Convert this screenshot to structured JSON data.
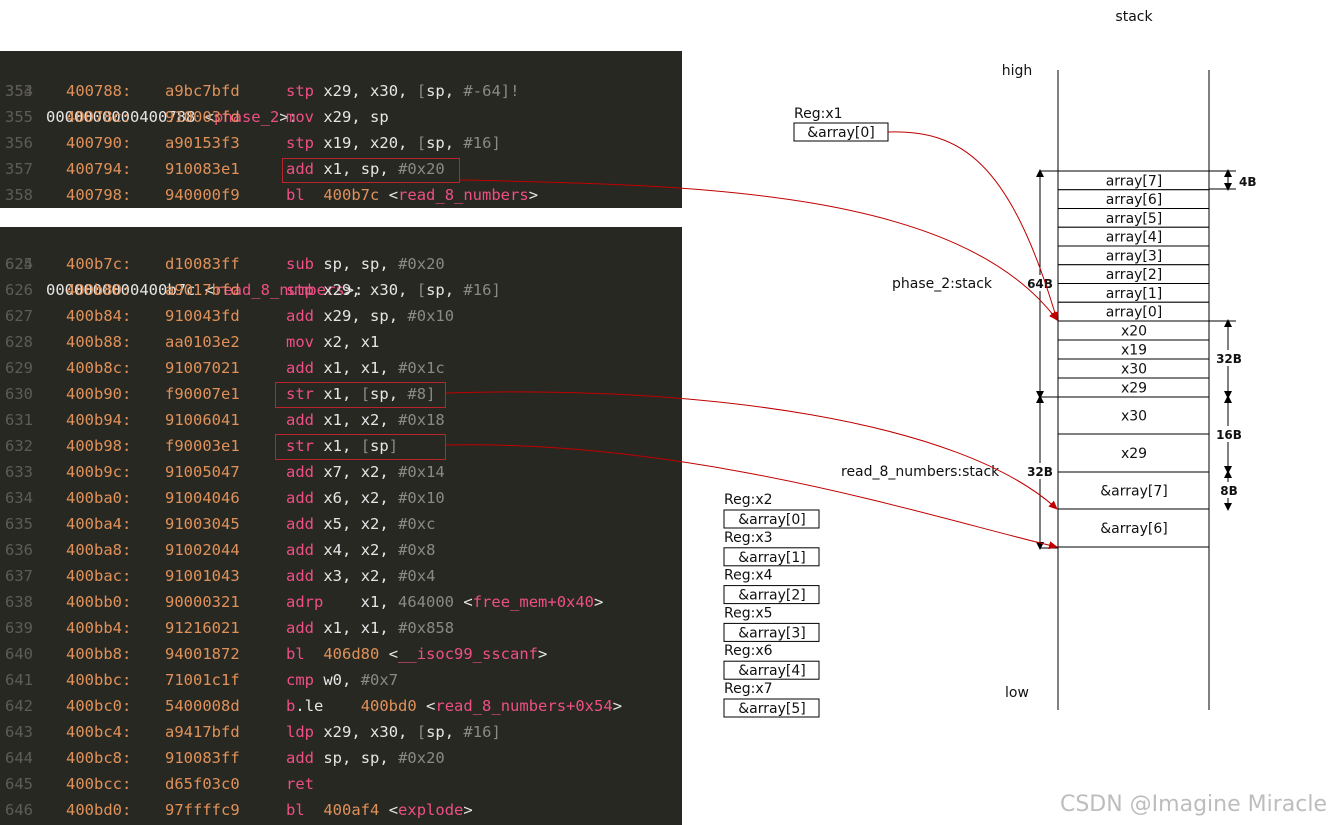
{
  "code_panel_1": {
    "header": {
      "line": "353",
      "address": "0000000000400788",
      "symbol": "phase_2"
    },
    "rows": [
      {
        "line": "354",
        "addr": "400788:",
        "hex": "a9bc7bfd",
        "ins": "stp x29, x30, [sp, #-64]!"
      },
      {
        "line": "355",
        "addr": "40078c:",
        "hex": "910003fd",
        "ins": "mov x29, sp"
      },
      {
        "line": "356",
        "addr": "400790:",
        "hex": "a90153f3",
        "ins": "stp x19, x20, [sp, #16]"
      },
      {
        "line": "357",
        "addr": "400794:",
        "hex": "910083e1",
        "ins": "add x1, sp, #0x20"
      },
      {
        "line": "358",
        "addr": "400798:",
        "hex": "940000f9",
        "ins": "bl  400b7c <read_8_numbers>"
      }
    ]
  },
  "code_panel_2": {
    "header": {
      "line": "624",
      "address": "0000000000400b7c",
      "symbol": "read_8_numbers"
    },
    "rows": [
      {
        "line": "625",
        "addr": "400b7c:",
        "hex": "d10083ff",
        "ins": "sub sp, sp, #0x20"
      },
      {
        "line": "626",
        "addr": "400b80:",
        "hex": "a9017bfd",
        "ins": "stp x29, x30, [sp, #16]"
      },
      {
        "line": "627",
        "addr": "400b84:",
        "hex": "910043fd",
        "ins": "add x29, sp, #0x10"
      },
      {
        "line": "628",
        "addr": "400b88:",
        "hex": "aa0103e2",
        "ins": "mov x2, x1"
      },
      {
        "line": "629",
        "addr": "400b8c:",
        "hex": "91007021",
        "ins": "add x1, x1, #0x1c"
      },
      {
        "line": "630",
        "addr": "400b90:",
        "hex": "f90007e1",
        "ins": "str x1, [sp, #8]"
      },
      {
        "line": "631",
        "addr": "400b94:",
        "hex": "91006041",
        "ins": "add x1, x2, #0x18"
      },
      {
        "line": "632",
        "addr": "400b98:",
        "hex": "f90003e1",
        "ins": "str x1, [sp]"
      },
      {
        "line": "633",
        "addr": "400b9c:",
        "hex": "91005047",
        "ins": "add x7, x2, #0x14"
      },
      {
        "line": "634",
        "addr": "400ba0:",
        "hex": "91004046",
        "ins": "add x6, x2, #0x10"
      },
      {
        "line": "635",
        "addr": "400ba4:",
        "hex": "91003045",
        "ins": "add x5, x2, #0xc"
      },
      {
        "line": "636",
        "addr": "400ba8:",
        "hex": "91002044",
        "ins": "add x4, x2, #0x8"
      },
      {
        "line": "637",
        "addr": "400bac:",
        "hex": "91001043",
        "ins": "add x3, x2, #0x4"
      },
      {
        "line": "638",
        "addr": "400bb0:",
        "hex": "90000321",
        "ins": "adrp    x1, 464000 <free_mem+0x40>"
      },
      {
        "line": "639",
        "addr": "400bb4:",
        "hex": "91216021",
        "ins": "add x1, x1, #0x858"
      },
      {
        "line": "640",
        "addr": "400bb8:",
        "hex": "94001872",
        "ins": "bl  406d80 <__isoc99_sscanf>"
      },
      {
        "line": "641",
        "addr": "400bbc:",
        "hex": "71001c1f",
        "ins": "cmp w0, #0x7"
      },
      {
        "line": "642",
        "addr": "400bc0:",
        "hex": "5400008d",
        "ins": "b.le    400bd0 <read_8_numbers+0x54>"
      },
      {
        "line": "643",
        "addr": "400bc4:",
        "hex": "a9417bfd",
        "ins": "ldp x29, x30, [sp, #16]"
      },
      {
        "line": "644",
        "addr": "400bc8:",
        "hex": "910083ff",
        "ins": "add sp, sp, #0x20"
      },
      {
        "line": "645",
        "addr": "400bcc:",
        "hex": "d65f03c0",
        "ins": "ret"
      },
      {
        "line": "646",
        "addr": "400bd0:",
        "hex": "97ffffc9",
        "ins": "bl  400af4 <explode>"
      }
    ]
  },
  "diagram": {
    "title": "stack",
    "high_label": "high",
    "low_label": "low",
    "phase2_label": "phase_2:stack",
    "read8_label": "read_8_numbers:stack",
    "reg_x1": {
      "label": "Reg:x1",
      "value": "&array[0]"
    },
    "array_cells": [
      "array[7]",
      "array[6]",
      "array[5]",
      "array[4]",
      "array[3]",
      "array[2]",
      "array[1]",
      "array[0]"
    ],
    "saved_regs_phase2": [
      "x20",
      "x19",
      "x30",
      "x29"
    ],
    "read8_cells": [
      "x30",
      "x29",
      "&array[7]",
      "&array[6]"
    ],
    "size_labels": {
      "s4": "4B",
      "s64": "64B",
      "s32a": "32B",
      "s16": "16B",
      "s32b": "32B",
      "s8": "8B"
    },
    "regs": [
      {
        "label": "Reg:x2",
        "value": "&array[0]"
      },
      {
        "label": "Reg:x3",
        "value": "&array[1]"
      },
      {
        "label": "Reg:x4",
        "value": "&array[2]"
      },
      {
        "label": "Reg:x5",
        "value": "&array[3]"
      },
      {
        "label": "Reg:x6",
        "value": "&array[4]"
      },
      {
        "label": "Reg:x7",
        "value": "&array[5]"
      }
    ],
    "arrow_color": "#c00000"
  },
  "watermark": "CSDN @Imagine Miracle"
}
